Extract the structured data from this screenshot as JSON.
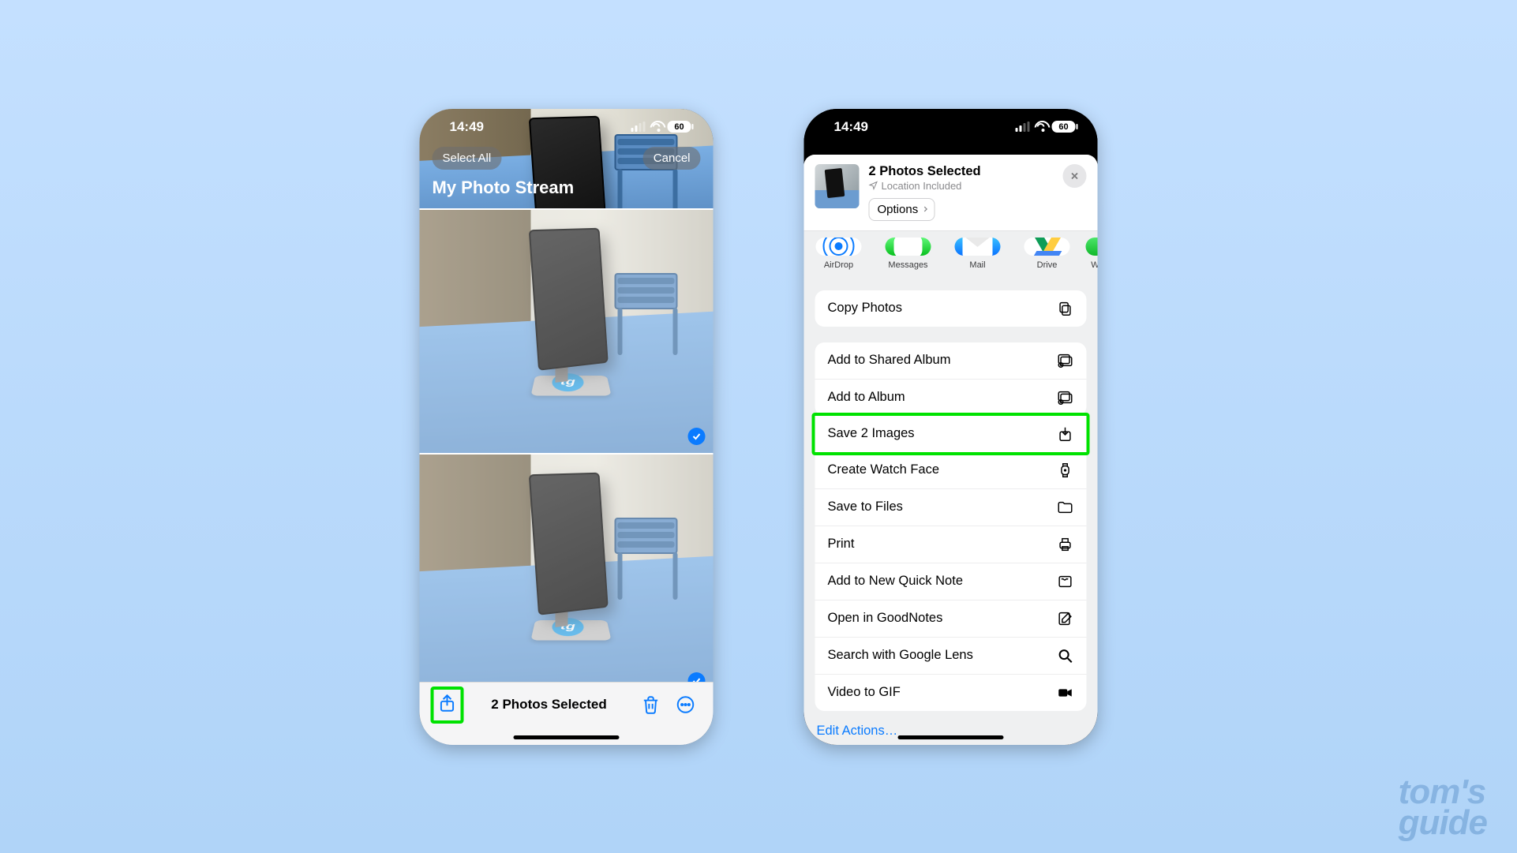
{
  "status": {
    "time": "14:49",
    "battery": "60"
  },
  "left": {
    "select_all_label": "Select All",
    "cancel_label": "Cancel",
    "album_title": "My Photo Stream",
    "toolbar_title": "2 Photos Selected"
  },
  "right": {
    "header": {
      "title": "2 Photos Selected",
      "subtitle": "Location Included",
      "options_label": "Options"
    },
    "share_targets": [
      {
        "label": "AirDrop"
      },
      {
        "label": "Messages"
      },
      {
        "label": "Mail"
      },
      {
        "label": "Drive"
      },
      {
        "label": "Wh"
      }
    ],
    "group1": [
      {
        "label": "Copy Photos",
        "icon": "copy"
      }
    ],
    "group2": [
      {
        "label": "Add to Shared Album",
        "icon": "shared-album"
      },
      {
        "label": "Add to Album",
        "icon": "album"
      },
      {
        "label": "Save 2 Images",
        "icon": "download",
        "highlighted": true
      },
      {
        "label": "Create Watch Face",
        "icon": "watch"
      },
      {
        "label": "Save to Files",
        "icon": "folder"
      },
      {
        "label": "Print",
        "icon": "printer"
      },
      {
        "label": "Add to New Quick Note",
        "icon": "note"
      },
      {
        "label": "Open in GoodNotes",
        "icon": "compose"
      },
      {
        "label": "Search with Google Lens",
        "icon": "search"
      },
      {
        "label": "Video to GIF",
        "icon": "video"
      }
    ],
    "edit_actions_label": "Edit Actions…"
  },
  "watermark": {
    "line1": "tom's",
    "line2": "guide"
  }
}
